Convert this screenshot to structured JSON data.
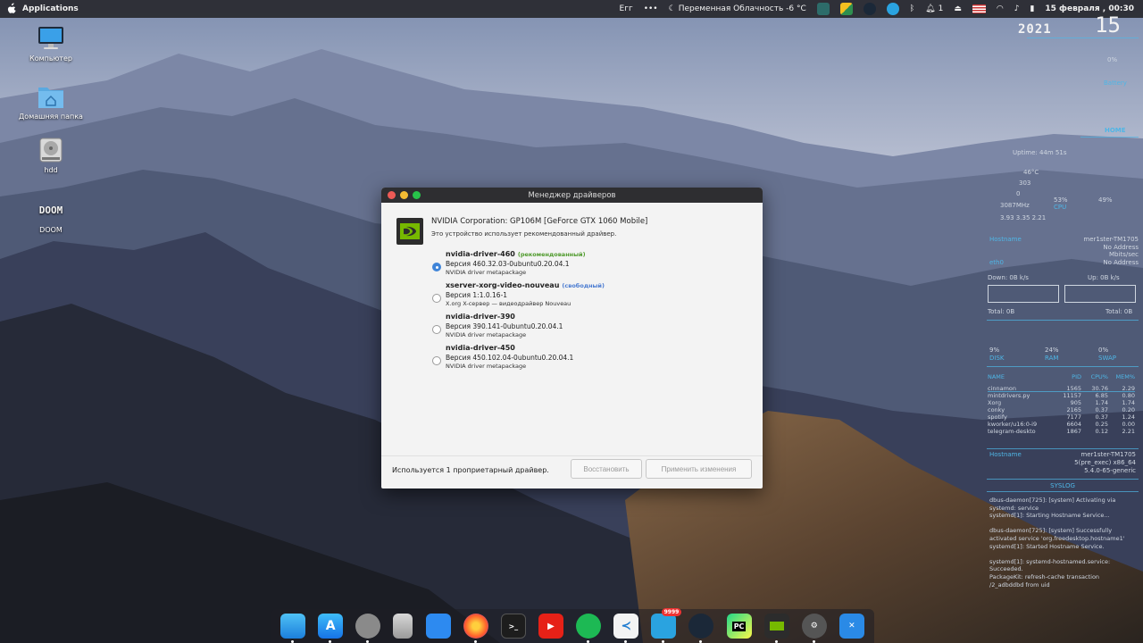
{
  "topbar": {
    "applications_label": "Applications",
    "keyboard_layout": "Eгг",
    "more": "•••",
    "weather": "Переменная Облачность -6 °C",
    "notification_count": "1",
    "datetime": "15 февраля , 00:30"
  },
  "desktop": {
    "computer": "Компьютер",
    "home": "Домашняя папка",
    "hdd": "hdd",
    "doom": "DOOM",
    "doom_logo_text": "DOOM"
  },
  "conky": {
    "year": "2021",
    "day": "15",
    "battery_percent": "0%",
    "battery_label": "Battery",
    "home_label": "HOME",
    "uptime": "Uptime: 44m 51s",
    "cpu_temp": "46°C",
    "fan": "303",
    "fan2": "0",
    "freq": "3087MHz",
    "cpu_load": "53%",
    "cpu_label": "CPU",
    "cpu2": "49%",
    "load_avg": "3.93 3.35 2.21",
    "hostname_label": "Hostname",
    "hostname": "mer1ster-TM1705",
    "wlan": "No Address",
    "speed": "Mbits/sec",
    "eth": "No Address",
    "eth_label": "eth0",
    "down": "Down: 0B  k/s",
    "up": "Up: 0B  k/s",
    "total_down": "Total: 0B",
    "total_up": "Total: 0B",
    "disk_pct": "9%",
    "disk_label": "DISK",
    "ram_pct": "24%",
    "ram_label": "RAM",
    "swap_pct": "0%",
    "swap_label": "SWAP",
    "processes": {
      "headers": [
        "NAME",
        "PID",
        "CPU%",
        "MEM%"
      ],
      "rows": [
        [
          "cinnamon",
          "1565",
          "30.76",
          "2.29"
        ],
        [
          "mintdrivers.py",
          "11157",
          "6.85",
          "0.80"
        ],
        [
          "Xorg",
          "905",
          "1.74",
          "1.74"
        ],
        [
          "conky",
          "2165",
          "0.37",
          "0.20"
        ],
        [
          "spotify",
          "7177",
          "0.37",
          "1.24"
        ],
        [
          "kworker/u16:0-i9",
          "6604",
          "0.25",
          "0.00"
        ],
        [
          "telegram-deskto",
          "1867",
          "0.12",
          "2.21"
        ]
      ]
    },
    "sys_hostname": "mer1ster-TM1705",
    "os": "5(pre_exec) x86_64",
    "kernel": "5.4.0-65-generic",
    "syslog_title": "SYSLOG",
    "syslog": "dbus-daemon[725]: [system] Activating via systemd: service\nsystemd[1]: Starting Hostname Service...\n\ndbus-daemon[725]: [system] Successfully activated service 'org.freedesktop.hostname1'\nsystemd[1]: Started Hostname Service.\n\nsystemd[1]: systemd-hostnamed.service: Succeeded.\nPackageKit: refresh-cache transaction /2_adbddbd from uid"
  },
  "dialog": {
    "title": "Менеджер драйверов",
    "device_name": "NVIDIA Corporation: GP106M [GeForce GTX 1060 Mobile]",
    "device_desc": "Это устройство использует рекомендованный драйвер.",
    "drivers": [
      {
        "name": "nvidia-driver-460",
        "tag": "(рекомендованный)",
        "tag_color": "#4f9a2c",
        "version": "Версия 460.32.03-0ubuntu0.20.04.1",
        "meta": "NVIDIA driver metapackage",
        "selected": true
      },
      {
        "name": "xserver-xorg-video-nouveau",
        "tag": "(свободный)",
        "tag_color": "#4a7bd1",
        "version": "Версия 1:1.0.16-1",
        "meta": "X.org X-сервер — видеодрайвер Nouveau",
        "selected": false
      },
      {
        "name": "nvidia-driver-390",
        "tag": "",
        "tag_color": "",
        "version": "Версия 390.141-0ubuntu0.20.04.1",
        "meta": "NVIDIA driver metapackage",
        "selected": false
      },
      {
        "name": "nvidia-driver-450",
        "tag": "",
        "tag_color": "",
        "version": "Версия 450.102.04-0ubuntu0.20.04.1",
        "meta": "NVIDIA driver metapackage",
        "selected": false
      }
    ],
    "status": "Используется 1 проприетарный драйвер.",
    "revert_button": "Восстановить",
    "apply_button": "Применить изменения"
  },
  "dock": {
    "badge_count": "9999",
    "pycharm_label": "PC",
    "terminal_label": ">_"
  },
  "colors": {
    "close": "#ed5a56",
    "minimize": "#f4bc33",
    "maximize": "#27c24a",
    "accent": "#4fb6e6"
  }
}
